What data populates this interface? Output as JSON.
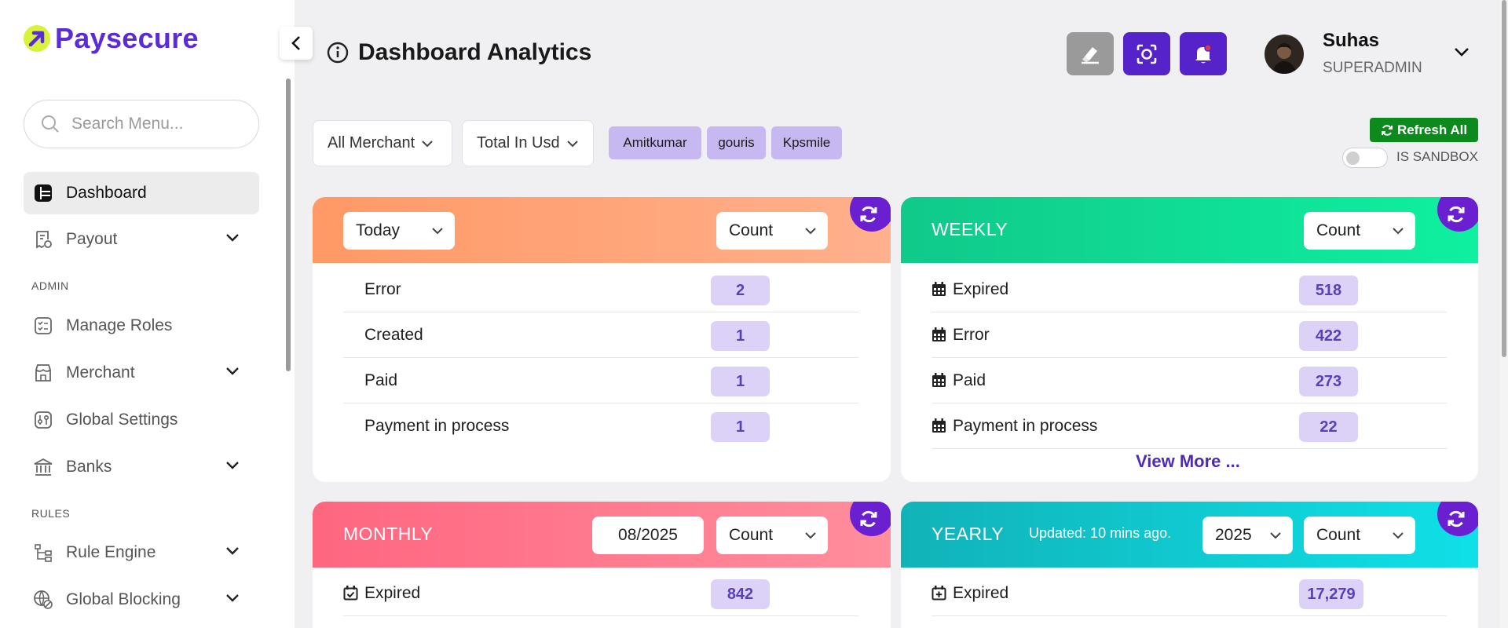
{
  "brand": {
    "name": "Paysecure"
  },
  "sidebar": {
    "search_placeholder": "Search Menu...",
    "items": [
      {
        "label": "Dashboard"
      },
      {
        "label": "Payout"
      },
      {
        "label": "Manage Roles"
      },
      {
        "label": "Merchant"
      },
      {
        "label": "Global Settings"
      },
      {
        "label": "Banks"
      },
      {
        "label": "Rule Engine"
      },
      {
        "label": "Global Blocking"
      }
    ],
    "sections": {
      "admin": "ADMIN",
      "rules": "RULES"
    }
  },
  "header": {
    "title": "Dashboard Analytics",
    "user_name": "Suhas",
    "user_role": "SUPERADMIN"
  },
  "filters": {
    "merchant": "All Merchant",
    "currency": "Total In Usd",
    "tags": [
      "Amitkumar",
      "gouris",
      "Kpsmile"
    ],
    "refresh_all": "Refresh All",
    "sandbox_label": "IS SANDBOX"
  },
  "cards": {
    "daily": {
      "period": "Today",
      "metric": "Count",
      "rows": [
        {
          "label": "Error",
          "value": "2"
        },
        {
          "label": "Created",
          "value": "1"
        },
        {
          "label": "Paid",
          "value": "1"
        },
        {
          "label": "Payment in process",
          "value": "1"
        }
      ]
    },
    "weekly": {
      "title": "WEEKLY",
      "metric": "Count",
      "rows": [
        {
          "label": "Expired",
          "value": "518"
        },
        {
          "label": "Error",
          "value": "422"
        },
        {
          "label": "Paid",
          "value": "273"
        },
        {
          "label": "Payment in process",
          "value": "22"
        }
      ],
      "view_more": "View More ..."
    },
    "monthly": {
      "title": "MONTHLY",
      "month": "08/2025",
      "metric": "Count",
      "rows": [
        {
          "label": "Expired",
          "value": "842"
        }
      ]
    },
    "yearly": {
      "title": "YEARLY",
      "updated": "Updated: 10 mins ago.",
      "year": "2025",
      "metric": "Count",
      "rows": [
        {
          "label": "Expired",
          "value": "17,279"
        }
      ]
    }
  },
  "colors": {
    "brand": "#5b2bd8",
    "daily_gradient": [
      "#ff9966",
      "#ffb08c"
    ],
    "weekly_gradient": [
      "#10c98a",
      "#0ff0a0"
    ],
    "monthly_gradient": [
      "#ff6680",
      "#ff8e9c"
    ],
    "yearly_gradient": [
      "#10b3b8",
      "#0fe0e8"
    ],
    "refresh_green": "#0d8a1e"
  }
}
